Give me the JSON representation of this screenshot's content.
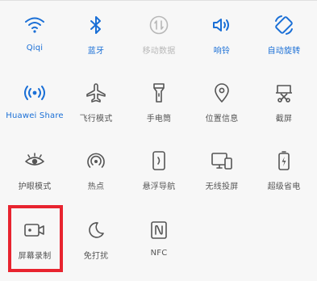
{
  "colors": {
    "active": "#1a6fd6",
    "inactive": "#555555",
    "disabled": "#b8b8b8",
    "highlight": "#e8242f"
  },
  "tiles": [
    {
      "label": "Qiqi",
      "icon": "wifi-icon",
      "state": "active"
    },
    {
      "label": "蓝牙",
      "icon": "bluetooth-icon",
      "state": "active"
    },
    {
      "label": "移动数据",
      "icon": "mobile-data-icon",
      "state": "disabled"
    },
    {
      "label": "响铃",
      "icon": "volume-icon",
      "state": "active"
    },
    {
      "label": "自动旋转",
      "icon": "auto-rotate-icon",
      "state": "active"
    },
    {
      "label": "Huawei Share",
      "icon": "huawei-share-icon",
      "state": "active"
    },
    {
      "label": "飞行模式",
      "icon": "airplane-icon",
      "state": "inactive"
    },
    {
      "label": "手电筒",
      "icon": "flashlight-icon",
      "state": "inactive"
    },
    {
      "label": "位置信息",
      "icon": "location-icon",
      "state": "inactive"
    },
    {
      "label": "截屏",
      "icon": "screenshot-icon",
      "state": "inactive"
    },
    {
      "label": "护眼模式",
      "icon": "eye-comfort-icon",
      "state": "inactive"
    },
    {
      "label": "热点",
      "icon": "hotspot-icon",
      "state": "inactive"
    },
    {
      "label": "悬浮导航",
      "icon": "floating-nav-icon",
      "state": "inactive"
    },
    {
      "label": "无线投屏",
      "icon": "wireless-projection-icon",
      "state": "inactive"
    },
    {
      "label": "超级省电",
      "icon": "battery-saver-icon",
      "state": "inactive"
    },
    {
      "label": "屏幕录制",
      "icon": "screen-record-icon",
      "state": "inactive"
    },
    {
      "label": "免打扰",
      "icon": "do-not-disturb-icon",
      "state": "inactive"
    },
    {
      "label": "NFC",
      "icon": "nfc-icon",
      "state": "inactive"
    }
  ]
}
